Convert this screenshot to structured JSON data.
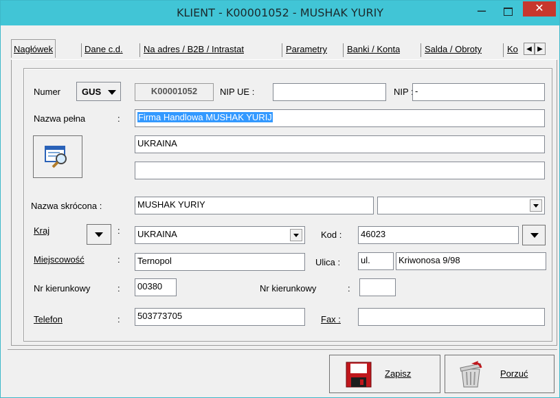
{
  "window": {
    "title": "KLIENT - K00001052 - MUSHAK YURIY",
    "minimize": "–",
    "close": "✕"
  },
  "tabs": [
    "Nagłówek",
    "Dane c.d.",
    "Na adres / B2B / Intrastat",
    "Parametry",
    "Banki / Konta",
    "Salda / Obroty",
    "Ko"
  ],
  "tab_scroll": {
    "left": "◀",
    "right": "▶"
  },
  "form": {
    "numer_label": "Numer",
    "numer_source": "GUS",
    "numer_value": "K00001052",
    "nip_ue_label": "NIP UE :",
    "nip_ue_value": "",
    "nip_label": "NIP :",
    "nip_value": "-",
    "nazwa_pelna_label": "Nazwa pełna",
    "colon": ":",
    "nazwa_pelna_line1": "Firma Handlowa  MUSHAK YURIJ",
    "nazwa_pelna_line2": "UKRAINA",
    "nazwa_pelna_line3": "",
    "nazwa_skrocona_label": "Nazwa skrócona :",
    "nazwa_skrocona_value": "MUSHAK YURIY",
    "nazwa_skrocona_extra": "",
    "kraj_label": "Kraj",
    "kraj_value": "UKRAINA",
    "kod_label": "Kod :",
    "kod_value": "46023",
    "miejscowosc_label": "Miejscowość",
    "miejscowosc_value": "Ternopol",
    "ulica_label": "Ulica :",
    "ulica_prefix": "ul.",
    "ulica_value": "Kriwonosa 9/98",
    "nr_kier_label": "Nr kierunkowy",
    "nr_kier_value": "00380",
    "nr_kier2_label": "Nr kierunkowy",
    "nr_kier2_value": "",
    "telefon_label": "Telefon",
    "telefon_value": "503773705",
    "fax_label": "Fax :",
    "fax_value": ""
  },
  "footer": {
    "save_label": "Zapisz",
    "cancel_label": "Porzuć"
  },
  "colors": {
    "titlebar": "#41c5d6",
    "close": "#c7372d",
    "selection": "#3399ff"
  }
}
